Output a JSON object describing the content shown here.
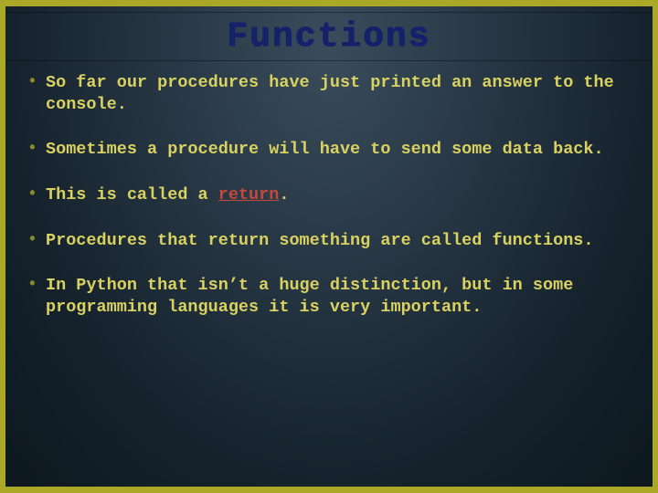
{
  "title": "Functions",
  "bullets": [
    {
      "pre": "So far our procedures have just printed an answer to the console.",
      "em": "",
      "post": ""
    },
    {
      "pre": "Sometimes a procedure will have to send some data back.",
      "em": "",
      "post": ""
    },
    {
      "pre": "This is called a ",
      "em": "return",
      "post": "."
    },
    {
      "pre": "Procedures that return something are called functions.",
      "em": "",
      "post": ""
    },
    {
      "pre": "In Python that isn’t a huge distinction, but in some programming languages it is very important.",
      "em": "",
      "post": ""
    }
  ]
}
